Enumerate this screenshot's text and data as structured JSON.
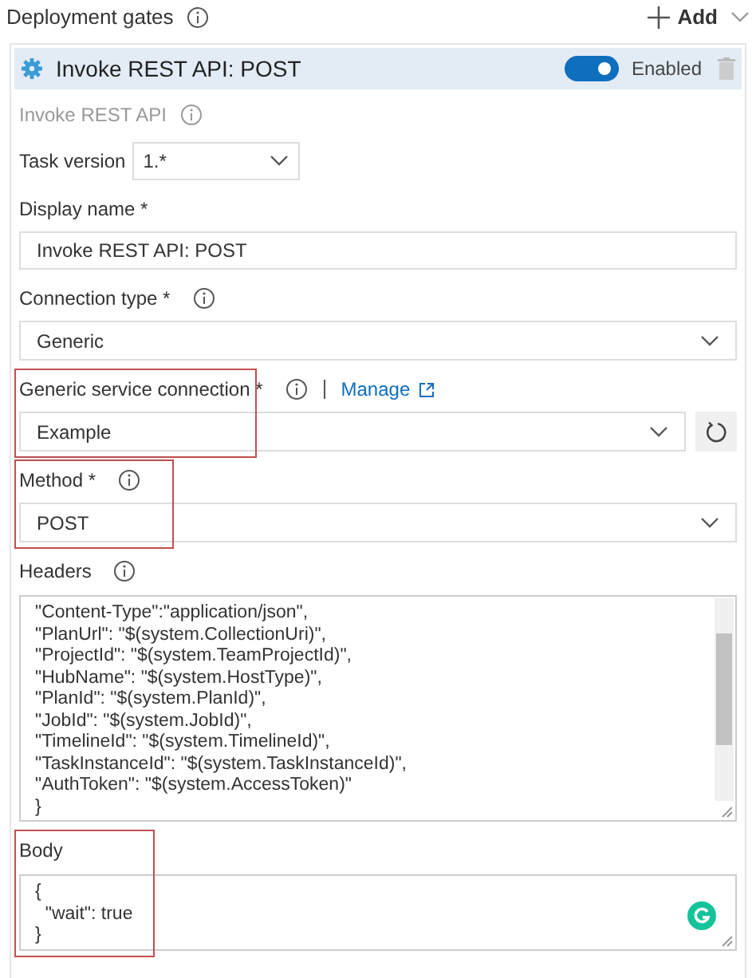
{
  "section": {
    "title": "Deployment gates",
    "add_label": "Add"
  },
  "task": {
    "title": "Invoke REST API: POST",
    "enabled": true,
    "enabled_label": "Enabled",
    "subtitle": "Invoke REST API"
  },
  "task_version": {
    "label": "Task version",
    "value": "1.*"
  },
  "fields": [
    {
      "kind": "text",
      "label": "Display name *",
      "value": "Invoke REST API: POST",
      "info": false,
      "highlighted": false
    },
    {
      "kind": "select",
      "label": "Connection type *",
      "value": "Generic",
      "info": true,
      "highlighted": false
    },
    {
      "kind": "service",
      "label": "Generic service connection *",
      "value": "Example",
      "info": true,
      "link": "Manage",
      "highlighted": true
    },
    {
      "kind": "select",
      "label": "Method *",
      "value": "POST",
      "info": true,
      "highlighted": true
    },
    {
      "kind": "code",
      "label": "Headers",
      "info": true,
      "highlighted": false,
      "lines": [
        "\"Content-Type\":\"application/json\",",
        "\"PlanUrl\": \"$(system.CollectionUri)\",",
        "\"ProjectId\": \"$(system.TeamProjectId)\",",
        "\"HubName\": \"$(system.HostType)\",",
        "\"PlanId\": \"$(system.PlanId)\",",
        "\"JobId\": \"$(system.JobId)\",",
        "\"TimelineId\": \"$(system.TimelineId)\",",
        "\"TaskInstanceId\": \"$(system.TaskInstanceId)\",",
        "\"AuthToken\": \"$(system.AccessToken)\"",
        "}"
      ]
    },
    {
      "kind": "body",
      "label": "Body",
      "info": false,
      "highlighted": true,
      "lines": [
        "{",
        "  \"wait\": true",
        "}"
      ]
    }
  ]
}
